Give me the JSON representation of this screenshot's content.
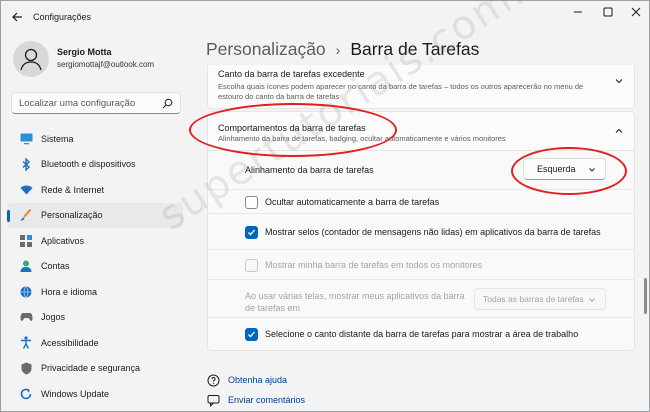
{
  "window": {
    "title": "Configurações"
  },
  "profile": {
    "name": "Sergio Motta",
    "email": "sergiomottajf@outlook.com"
  },
  "search": {
    "placeholder": "Localizar uma configuração"
  },
  "nav": {
    "items": [
      {
        "label": "Sistema",
        "icon": "monitor-icon"
      },
      {
        "label": "Bluetooth e dispositivos",
        "icon": "bluetooth-icon"
      },
      {
        "label": "Rede & Internet",
        "icon": "wifi-icon"
      },
      {
        "label": "Personalização",
        "icon": "brush-icon",
        "active": true
      },
      {
        "label": "Aplicativos",
        "icon": "apps-icon"
      },
      {
        "label": "Contas",
        "icon": "person-icon"
      },
      {
        "label": "Hora e idioma",
        "icon": "globe-icon"
      },
      {
        "label": "Jogos",
        "icon": "gamepad-icon"
      },
      {
        "label": "Acessibilidade",
        "icon": "accessibility-icon"
      },
      {
        "label": "Privacidade e segurança",
        "icon": "shield-icon"
      },
      {
        "label": "Windows Update",
        "icon": "update-icon"
      }
    ]
  },
  "breadcrumb": {
    "parent": "Personalização",
    "separator": "›",
    "current": "Barra de Tarefas"
  },
  "sections": {
    "overflow": {
      "title": "Canto da barra de tarefas excedente",
      "subtitle": "Escolha quais ícones podem aparecer no canto da barra de tarefas – todos os outros aparecerão no menu de estouro do canto da barra de tarefas"
    },
    "behaviors": {
      "title": "Comportamentos da barra de tarefas",
      "subtitle": "Alinhamento da barra de tarefas, badging, ocultar automaticamente e vários monitores",
      "alignment_label": "Alinhamento da barra de tarefas",
      "alignment_value": "Esquerda",
      "options": [
        {
          "label": "Ocultar automaticamente a barra de tarefas",
          "checked": false,
          "disabled": false
        },
        {
          "label": "Mostrar selos (contador de mensagens não lidas) em aplicativos da barra de tarefas",
          "checked": true,
          "disabled": false
        },
        {
          "label": "Mostrar minha barra de tarefas em todos os monitores",
          "checked": false,
          "disabled": true
        }
      ],
      "multi_label": "Ao usar várias telas, mostrar meus aplicativos da barra de tarefas em",
      "multi_value": "Todas as barras de tarefas",
      "far_corner_label": "Selecione o canto distante da barra de tarefas para mostrar a área de trabalho",
      "far_corner_checked": true
    }
  },
  "footer": {
    "help": "Obtenha ajuda",
    "feedback": "Enviar comentários"
  },
  "watermark": "supertutoriais.com.br",
  "colors": {
    "accent": "#0067c0",
    "annotation": "#e02020",
    "link": "#003e92"
  }
}
